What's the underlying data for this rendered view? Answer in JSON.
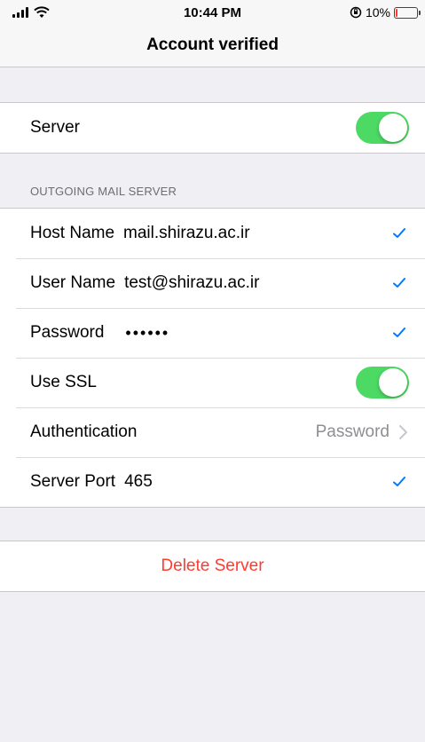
{
  "status_bar": {
    "time": "10:44 PM",
    "battery_text": "10%",
    "battery_level": 0.1,
    "battery_color": "#ff3b30"
  },
  "nav": {
    "title": "Account verified"
  },
  "server_group": {
    "label": "Server",
    "enabled": true
  },
  "outgoing": {
    "header": "OUTGOING MAIL SERVER",
    "host_name": {
      "label": "Host Name",
      "value": "mail.shirazu.ac.ir"
    },
    "user_name": {
      "label": "User Name",
      "value": "test@shirazu.ac.ir"
    },
    "password": {
      "label": "Password",
      "value": "••••••"
    },
    "use_ssl": {
      "label": "Use SSL",
      "enabled": true
    },
    "authentication": {
      "label": "Authentication",
      "value": "Password"
    },
    "server_port": {
      "label": "Server Port",
      "value": "465"
    }
  },
  "actions": {
    "delete_label": "Delete Server"
  },
  "colors": {
    "accent": "#007aff",
    "toggle_on": "#4cd964",
    "destructive": "#ff3b30"
  }
}
